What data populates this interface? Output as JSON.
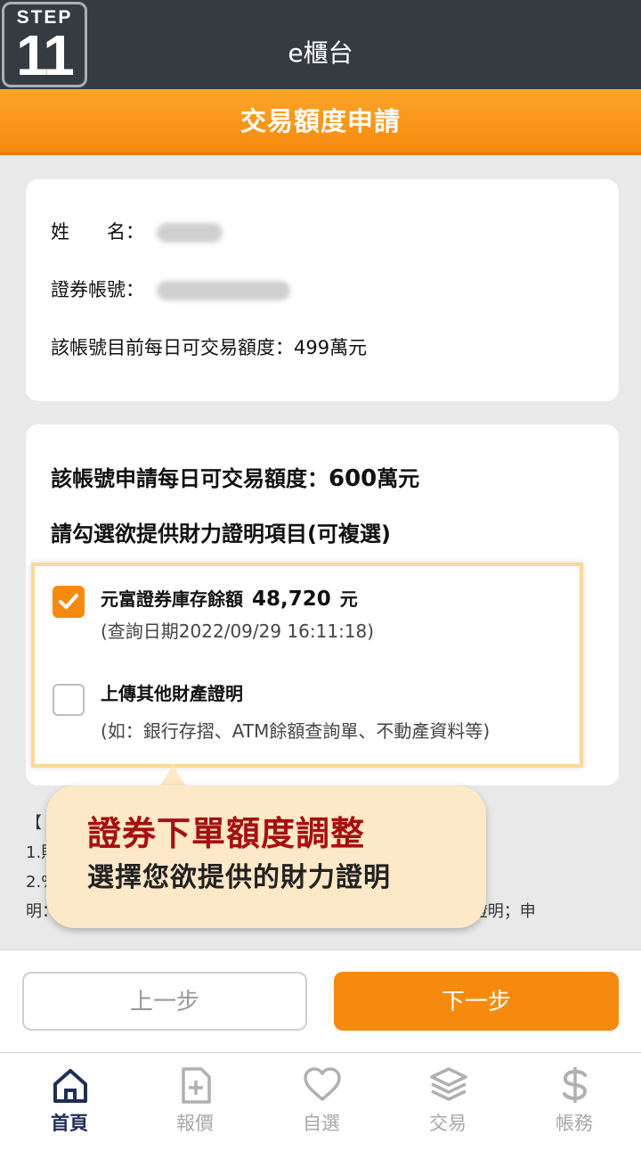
{
  "step": {
    "label": "STEP",
    "number": "11"
  },
  "header": {
    "app_title": "e櫃台",
    "page_title": "交易額度申請"
  },
  "account_card": {
    "name_label": "姓　　名：",
    "account_label": "證券帳號：",
    "limit_text": "該帳號目前每日可交易額度：499萬元"
  },
  "apply_card": {
    "apply_label": "該帳號申請每日可交易額度：",
    "apply_amount": "600",
    "apply_unit": "萬元",
    "select_label": "請勾選欲提供財力證明項目(可複選)",
    "options": [
      {
        "title": "元富證券庫存餘額",
        "balance": "48,720",
        "unit": "元",
        "sub": "(查詢日期2022/09/29 16:11:18)",
        "checked": true
      },
      {
        "title": "上傳其他財產證明",
        "sub": "(如：銀行存摺、ATM餘額查詢單、不動產資料等)",
        "checked": false
      }
    ]
  },
  "notes": [
    "【",
    "1.則                                                        總合計。",
    "2.%                                                        30%，範例說",
    "明：如欲申請之可交易額度為600萬，則提供150萬以上之財力證明；申"
  ],
  "callout": {
    "title": "證券下單額度調整",
    "subtitle": "選擇您欲提供的財力證明"
  },
  "buttons": {
    "prev": "上一步",
    "next": "下一步"
  },
  "tabs": [
    {
      "label": "首頁",
      "icon": "home-icon",
      "active": true
    },
    {
      "label": "報價",
      "icon": "quote-icon",
      "active": false
    },
    {
      "label": "自選",
      "icon": "heart-icon",
      "active": false
    },
    {
      "label": "交易",
      "icon": "layers-icon",
      "active": false
    },
    {
      "label": "帳務",
      "icon": "dollar-icon",
      "active": false
    }
  ],
  "colors": {
    "accent": "#f68a0e",
    "header": "#343c42",
    "callout_title": "#a6100f",
    "active_tab": "#1f2f57"
  }
}
